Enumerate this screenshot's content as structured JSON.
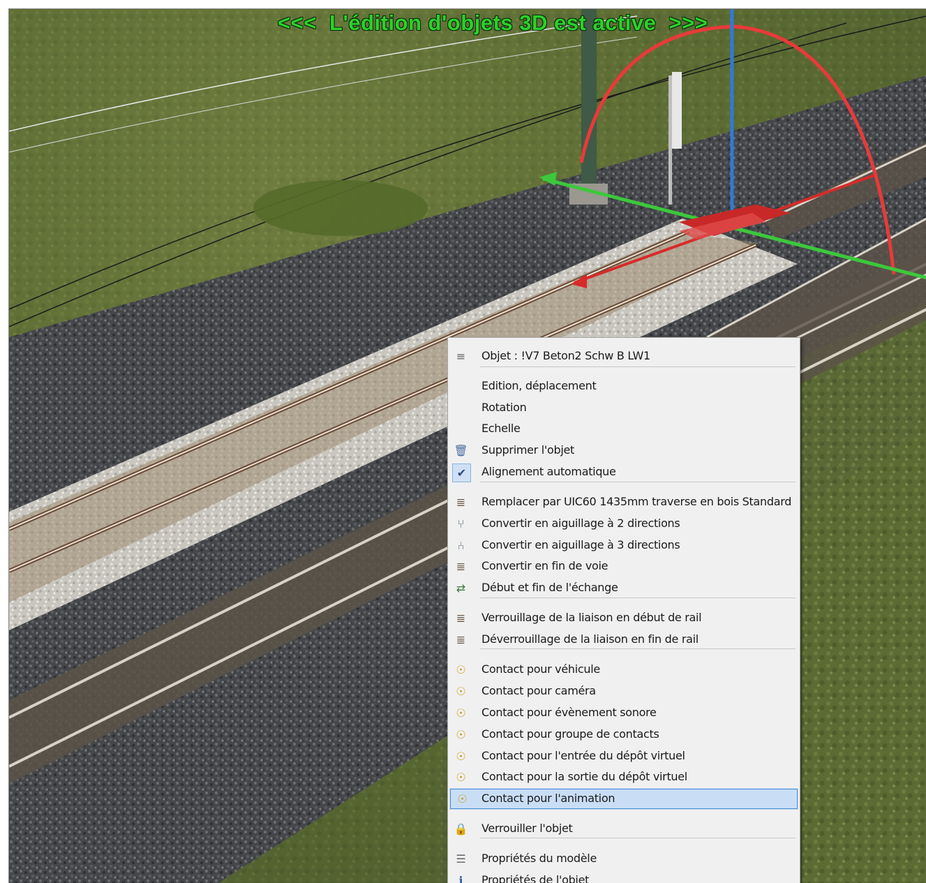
{
  "viewport": {
    "banner": "<<<  L'édition d'objets 3D est active  >>>",
    "banner_color": "#2bd12b"
  },
  "context_menu": {
    "items": [
      {
        "label": "Objet : !V7 Beton2 Schw B LW1",
        "icon": "track-info-icon",
        "checked": false
      },
      {
        "label": "Edition, déplacement",
        "icon": "",
        "checked": false
      },
      {
        "label": "Rotation",
        "icon": "",
        "checked": false
      },
      {
        "label": "Echelle",
        "icon": "",
        "checked": false
      },
      {
        "label": "Supprimer l'objet",
        "icon": "trash-icon",
        "checked": false
      },
      {
        "label": "Alignement automatique",
        "icon": "checkmark-icon",
        "checked": true
      },
      {
        "label": "Remplacer par UIC60 1435mm traverse en bois Standard",
        "icon": "track-replace-icon",
        "checked": false
      },
      {
        "label": "Convertir en aiguillage à 2 directions",
        "icon": "switch-2way-icon",
        "checked": false
      },
      {
        "label": "Convertir en aiguillage à 3 directions",
        "icon": "switch-3way-icon",
        "checked": false
      },
      {
        "label": "Convertir en fin de voie",
        "icon": "track-end-icon",
        "checked": false
      },
      {
        "label": "Début et fin de l'échange",
        "icon": "track-exchange-icon",
        "checked": false
      },
      {
        "label": "Verrouillage de la liaison en début de rail",
        "icon": "lock-start-icon",
        "checked": false
      },
      {
        "label": "Déverrouillage de la liaison en fin de rail",
        "icon": "unlock-end-icon",
        "checked": false
      },
      {
        "label": "Contact pour véhicule",
        "icon": "contact-icon",
        "checked": false
      },
      {
        "label": "Contact pour caméra",
        "icon": "contact-icon",
        "checked": false
      },
      {
        "label": "Contact pour évènement sonore",
        "icon": "contact-icon",
        "checked": false
      },
      {
        "label": "Contact pour groupe de contacts",
        "icon": "contact-icon",
        "checked": false
      },
      {
        "label": "Contact pour l'entrée du dépôt virtuel",
        "icon": "contact-icon",
        "checked": false
      },
      {
        "label": "Contact pour la sortie du dépôt virtuel",
        "icon": "contact-icon",
        "checked": false
      },
      {
        "label": "Contact pour l'animation",
        "icon": "contact-icon",
        "checked": false,
        "highlighted": true
      },
      {
        "label": "Verrouiller l'objet",
        "icon": "padlock-icon",
        "checked": false
      },
      {
        "label": "Propriétés du modèle",
        "icon": "model-properties-icon",
        "checked": false
      },
      {
        "label": "Propriétés de l'objet",
        "icon": "object-properties-icon",
        "checked": false
      }
    ]
  }
}
